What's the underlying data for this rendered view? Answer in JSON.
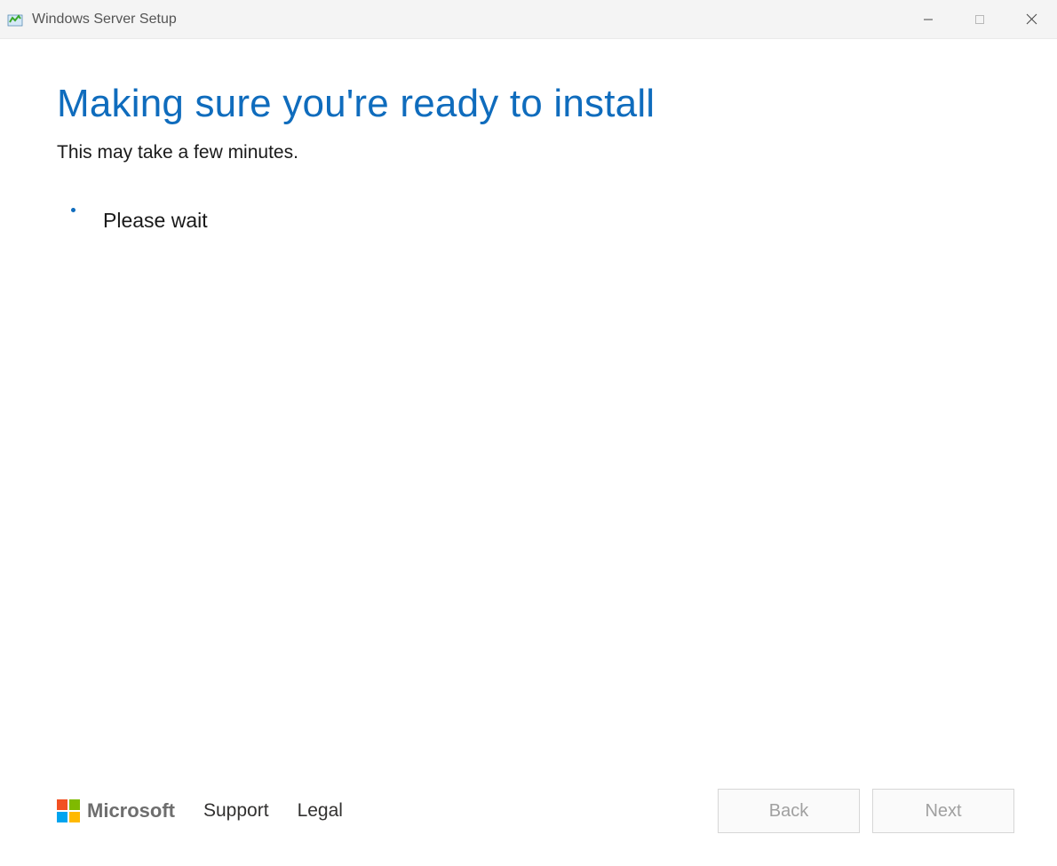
{
  "titlebar": {
    "title": "Windows Server Setup"
  },
  "main": {
    "heading": "Making sure you're ready to install",
    "subheading": "This may take a few minutes.",
    "progress_label": "Please wait"
  },
  "footer": {
    "brand": "Microsoft",
    "support_label": "Support",
    "legal_label": "Legal",
    "back_label": "Back",
    "next_label": "Next"
  }
}
